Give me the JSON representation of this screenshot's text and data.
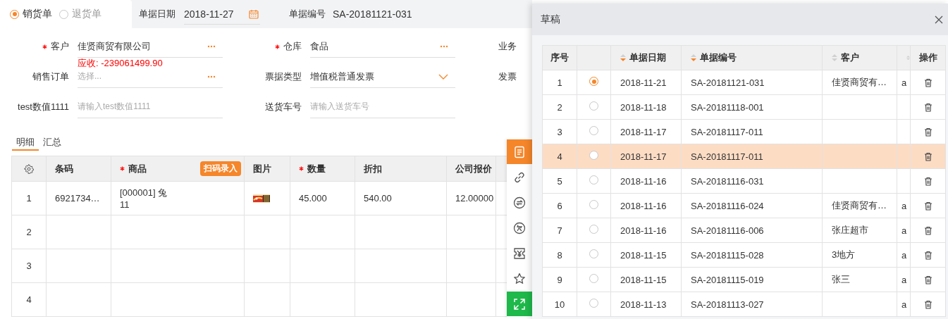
{
  "order_type": [
    {
      "label": "销货单",
      "selected": true
    },
    {
      "label": "退货单",
      "selected": false
    }
  ],
  "header_fields": [
    {
      "label": "单据日期",
      "value": "2018-11-27",
      "kind": "date"
    },
    {
      "label": "单据编号",
      "value": "SA-20181121-031",
      "kind": "text"
    }
  ],
  "form_fields": [
    {
      "label": "客户",
      "required": true,
      "kind": "picker",
      "value": "佳贤商贸有限公司",
      "note": "应收: -239061499.90"
    },
    {
      "label": "仓库",
      "required": true,
      "kind": "picker",
      "value": "食品"
    },
    {
      "label": "业务",
      "kind": "clipped"
    },
    {
      "label": "销售订单",
      "required": false,
      "kind": "picker",
      "placeholder": "选择..."
    },
    {
      "label": "票据类型",
      "required": false,
      "kind": "select",
      "value": "增值税普通发票"
    },
    {
      "label": "发票",
      "kind": "clipped"
    },
    {
      "label": "test数值1111",
      "required": false,
      "kind": "input",
      "placeholder": "请输入test数值1111"
    },
    {
      "label": "送货车号",
      "required": false,
      "kind": "input",
      "placeholder": "请输入送货车号"
    }
  ],
  "detail_tabs": [
    {
      "label": "明细",
      "selected": true
    },
    {
      "label": "汇总",
      "selected": false
    }
  ],
  "detail_table": {
    "columns": [
      {
        "kind": "settings"
      },
      {
        "kind": "text",
        "label": "条码",
        "required": false
      },
      {
        "kind": "text",
        "label": "商品",
        "required": true,
        "action": "扫码录入"
      },
      {
        "kind": "text",
        "label": "图片",
        "required": false
      },
      {
        "kind": "text",
        "label": "数量",
        "required": true
      },
      {
        "kind": "text",
        "label": "折扣",
        "required": false
      },
      {
        "kind": "text",
        "label": "公司报价",
        "required": false
      }
    ],
    "rows": [
      {
        "index": "1",
        "barcode": "6921734…",
        "product": "[000001] 兔 11",
        "quantity": "45.000",
        "discount": "540.00",
        "price": "12.00000"
      },
      {
        "index": "2"
      },
      {
        "index": "3"
      },
      {
        "index": "4"
      }
    ]
  },
  "toolbar": [
    {
      "kind": "tool",
      "selected": true
    },
    {
      "kind": "tool",
      "selected": false
    },
    {
      "kind": "tool",
      "selected": false
    },
    {
      "kind": "tool",
      "selected": false
    },
    {
      "kind": "tool",
      "selected": false
    },
    {
      "kind": "tool",
      "selected": false
    },
    {
      "kind": "action",
      "selected": false
    }
  ],
  "drafts": {
    "title": "草稿",
    "columns": [
      {
        "kind": "text",
        "label": "序号"
      },
      {
        "kind": "radio"
      },
      {
        "kind": "sort",
        "label": "单据日期",
        "sorted": true
      },
      {
        "kind": "sort",
        "label": "单据编号",
        "sorted": true
      },
      {
        "kind": "sort",
        "label": "客户",
        "sorted": false
      },
      {
        "kind": "sort",
        "sorted": false
      },
      {
        "kind": "text",
        "label": "操作"
      }
    ],
    "rows": [
      {
        "index": "1",
        "selected": true,
        "highlighted": false,
        "date": "2018-11-21",
        "number": "SA-20181121-031",
        "customer": "佳贤商贸有…",
        "column_6": "a"
      },
      {
        "index": "2",
        "selected": false,
        "highlighted": false,
        "date": "2018-11-18",
        "number": "SA-20181118-001"
      },
      {
        "index": "3",
        "selected": false,
        "highlighted": false,
        "date": "2018-11-17",
        "number": "SA-20181117-011"
      },
      {
        "index": "4",
        "selected": false,
        "highlighted": true,
        "date": "2018-11-17",
        "number": "SA-20181117-011"
      },
      {
        "index": "5",
        "selected": false,
        "highlighted": false,
        "date": "2018-11-16",
        "number": "SA-20181116-031"
      },
      {
        "index": "6",
        "selected": false,
        "highlighted": false,
        "date": "2018-11-16",
        "number": "SA-20181116-024",
        "customer": "佳贤商贸有…",
        "column_6": "a"
      },
      {
        "index": "7",
        "selected": false,
        "highlighted": false,
        "date": "2018-11-16",
        "number": "SA-20181116-006",
        "customer": "张庄超市",
        "column_6": "a"
      },
      {
        "index": "8",
        "selected": false,
        "highlighted": false,
        "date": "2018-11-15",
        "number": "SA-20181115-028",
        "customer": "3地方",
        "column_6": "a"
      },
      {
        "index": "9",
        "selected": false,
        "highlighted": false,
        "date": "2018-11-15",
        "number": "SA-20181115-019",
        "customer": "张三",
        "column_6": "a"
      },
      {
        "index": "10",
        "selected": false,
        "highlighted": false,
        "date": "2018-11-13",
        "number": "SA-20181113-027",
        "column_6": "a"
      }
    ]
  }
}
